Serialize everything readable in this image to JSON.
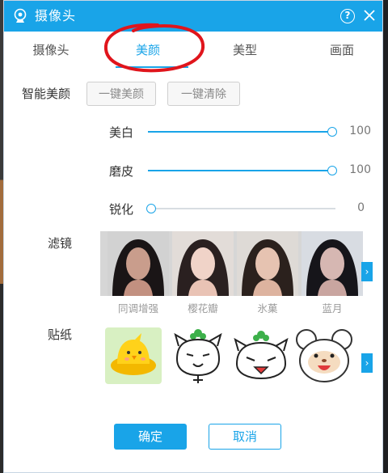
{
  "window": {
    "title": "摄像头",
    "help": "?"
  },
  "tabs": [
    {
      "label": "摄像头"
    },
    {
      "label": "美颜"
    },
    {
      "label": "美型"
    },
    {
      "label": "画面"
    }
  ],
  "beauty": {
    "label": "智能美颜",
    "one_click_beauty": "一键美颜",
    "one_click_clear": "一键清除"
  },
  "sliders": [
    {
      "label": "美白",
      "value": "100",
      "level": 100
    },
    {
      "label": "磨皮",
      "value": "100",
      "level": 100
    },
    {
      "label": "锐化",
      "value": "0",
      "level": 0
    }
  ],
  "filters": {
    "label": "滤镜",
    "items": [
      {
        "name": "同调增强"
      },
      {
        "name": "樱花瓣"
      },
      {
        "name": "氷菓"
      },
      {
        "name": "蓝月"
      }
    ]
  },
  "stickers": {
    "label": "贴纸",
    "items": [
      "yellow-chick-hat",
      "sprout-cat",
      "sprout-cat-angry",
      "mouse-face"
    ]
  },
  "actions": {
    "confirm": "确定",
    "cancel": "取消"
  },
  "colors": {
    "accent": "#19a4e8",
    "annotation": "#e0151c"
  }
}
